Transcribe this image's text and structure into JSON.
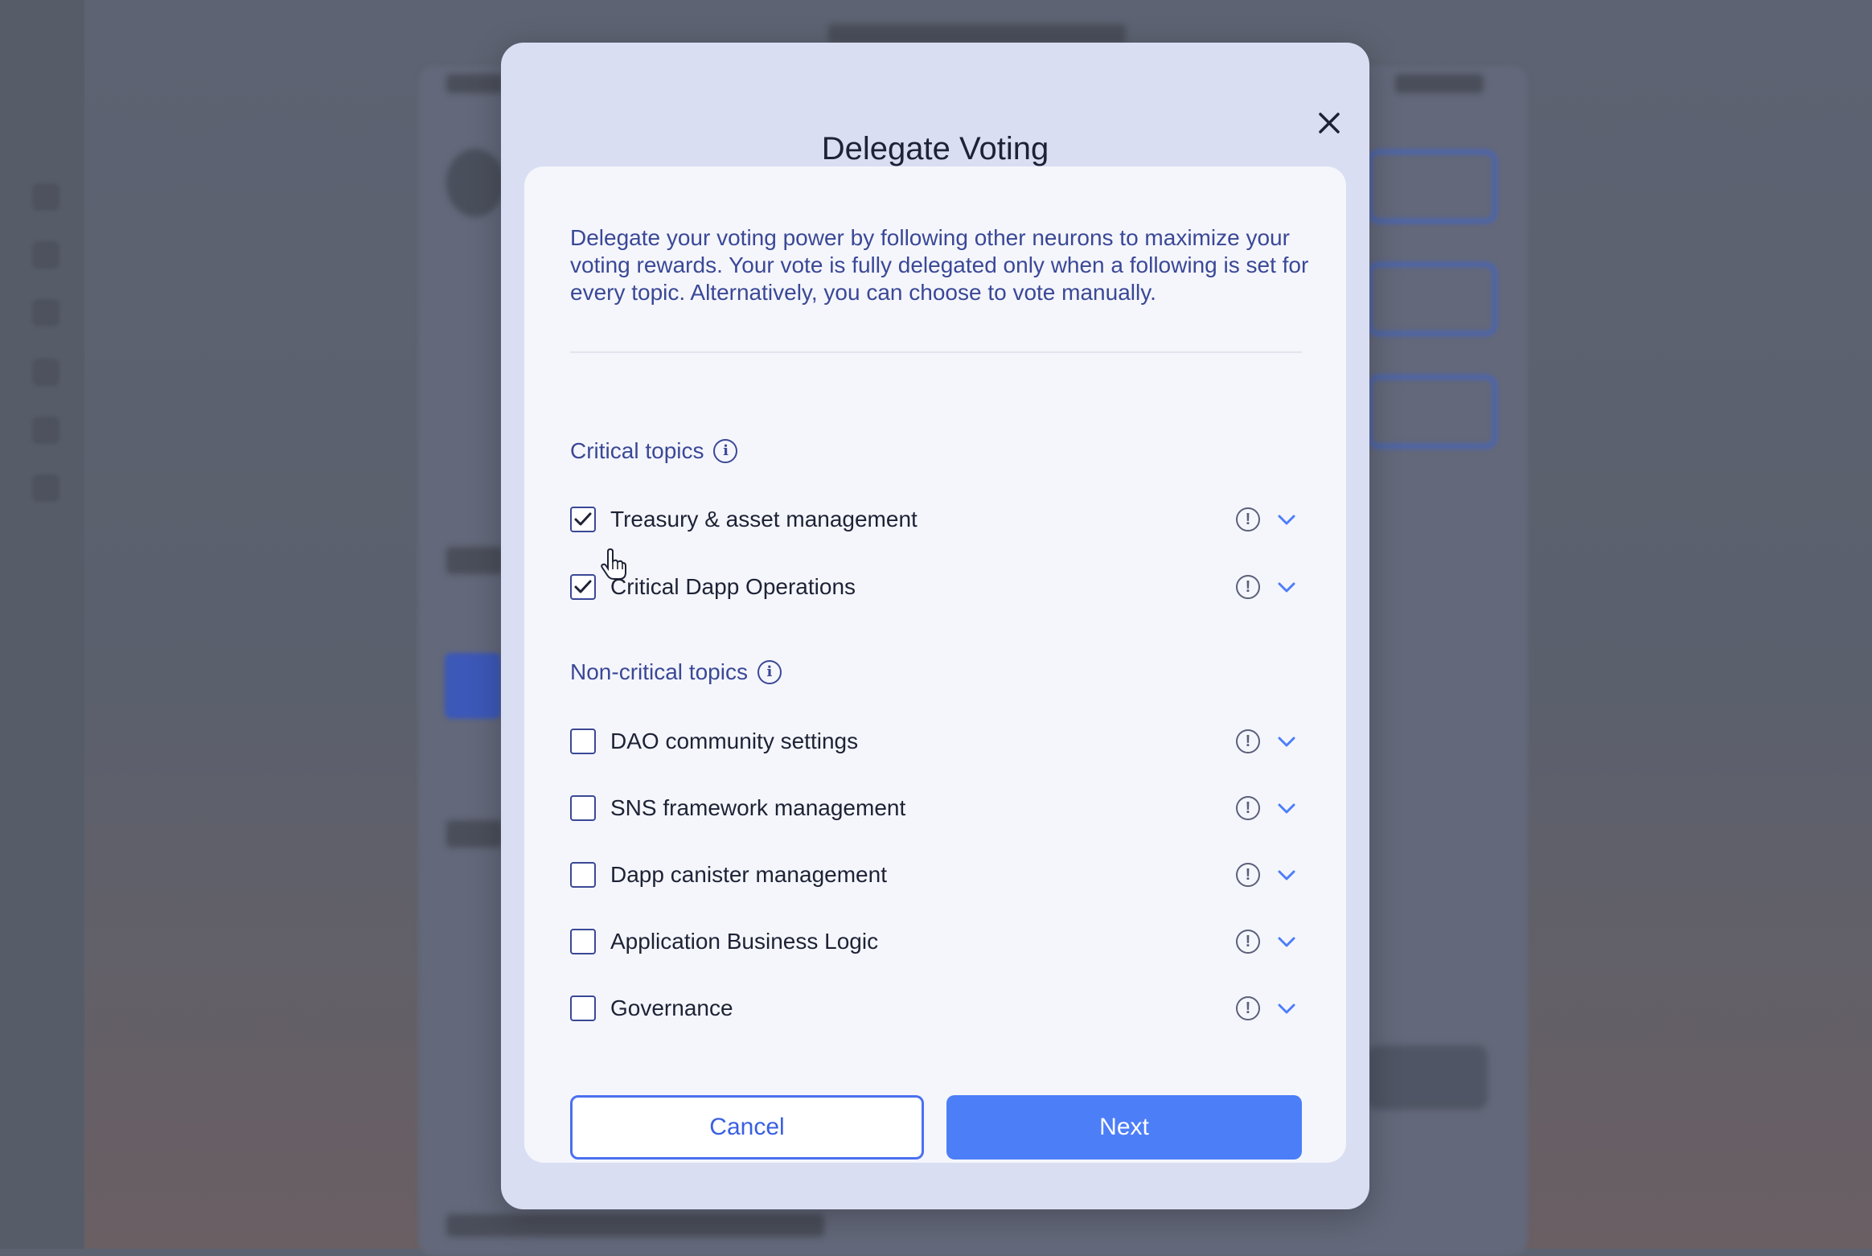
{
  "modal": {
    "title": "Delegate Voting",
    "intro": "Delegate your voting power by following other neurons to maximize your voting rewards. Your vote is fully delegated only when a following is set for every topic. Alternatively, you can choose to vote manually.",
    "sections": [
      {
        "title": "Critical topics",
        "topics": [
          {
            "label": "Treasury & asset management",
            "checked": true
          },
          {
            "label": "Critical Dapp Operations",
            "checked": true
          }
        ]
      },
      {
        "title": "Non-critical topics",
        "topics": [
          {
            "label": "DAO community settings",
            "checked": false
          },
          {
            "label": "SNS framework management",
            "checked": false
          },
          {
            "label": "Dapp canister management",
            "checked": false
          },
          {
            "label": "Application Business Logic",
            "checked": false
          },
          {
            "label": "Governance",
            "checked": false
          }
        ]
      }
    ],
    "cancel_label": "Cancel",
    "next_label": "Next"
  },
  "colors": {
    "accent": "#4c7ef8",
    "text_blue": "#3a4896",
    "modal_bg": "#d9def2",
    "card_bg": "#f5f6fc"
  },
  "icons": [
    "close-icon",
    "info-icon",
    "warning-icon",
    "chevron-down-icon",
    "checkmark-icon",
    "hand-cursor-icon"
  ]
}
